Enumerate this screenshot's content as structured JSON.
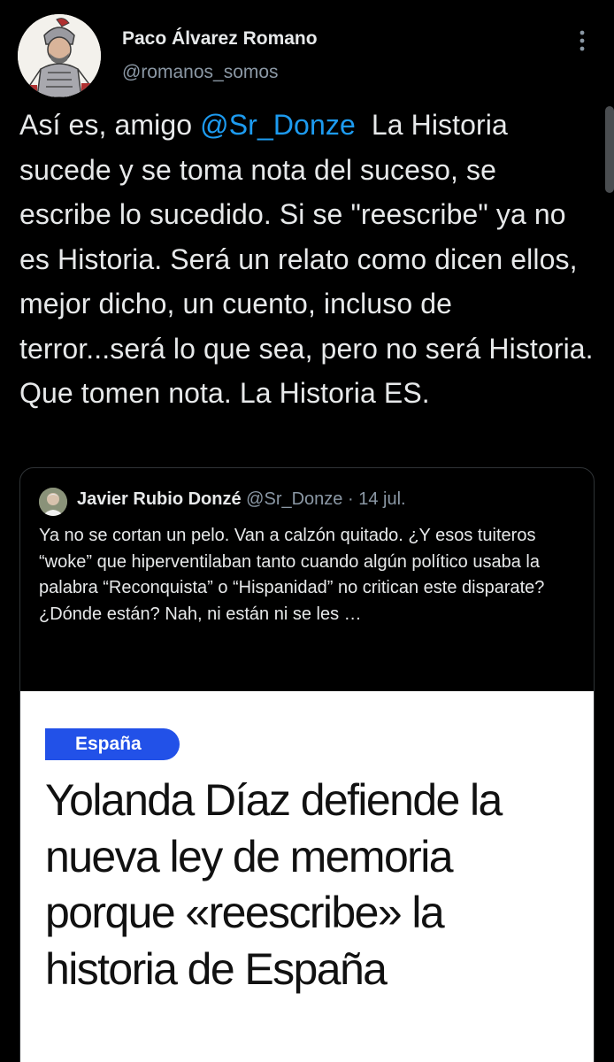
{
  "tweet": {
    "author": {
      "display_name": "Paco Álvarez Romano",
      "handle": "@romanos_somos",
      "avatar_icon": "roman-soldier-avatar-icon"
    },
    "menu_icon": "more-options-icon",
    "text_before_mention": "Así es, amigo ",
    "mention": "@Sr_Donze",
    "text_after_mention": "  La Historia sucede y se toma nota del suceso, se escribe lo sucedido. Si se \"reescribe\" ya no es Historia. Será un relato como dicen ellos, mejor dicho, un cuento, incluso de terror...será lo que sea, pero no será Historia. Que tomen nota. La Historia ES."
  },
  "quoted_tweet": {
    "author_name": "Javier Rubio Donzé",
    "handle": "@Sr_Donze",
    "separator": " · ",
    "date": "14 jul.",
    "avatar_icon": "person-avatar-icon",
    "text": "Ya no se cortan un pelo. Van a calzón quitado. ¿Y esos tuiteros “woke” que hiperventilaban tanto cuando algún político usaba la palabra “Reconquista” o “Hispanidad” no critican este disparate? ¿Dónde están? Nah, ni están ni se les …",
    "media": {
      "section_tag": "España",
      "headline": "Yolanda Díaz defiende la nueva ley de memoria porque «reescribe» la historia de España"
    }
  },
  "colors": {
    "background": "#000000",
    "primary_text": "#e7e9ea",
    "secondary_text": "#8b98a5",
    "mention": "#1d9bf0",
    "border": "#2f3336",
    "tag_blue": "#2251e8"
  }
}
